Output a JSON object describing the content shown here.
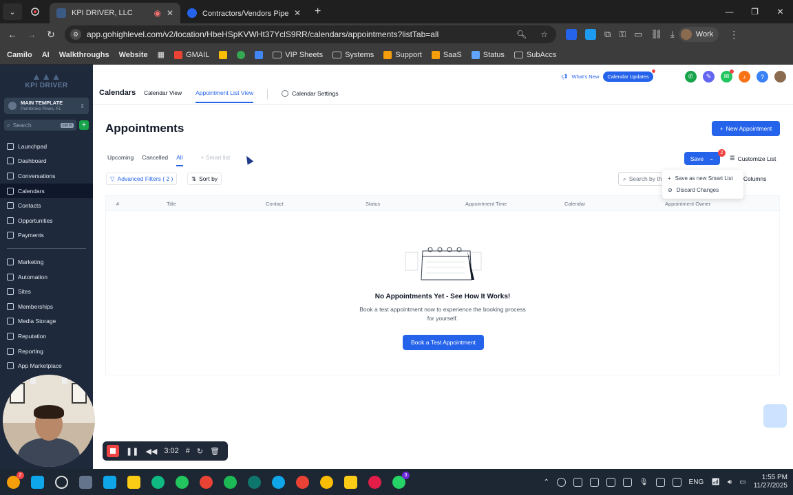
{
  "browser": {
    "tabs": [
      {
        "title": "KPI DRIVER, LLC",
        "active": true
      },
      {
        "title": "Contractors/Vendors Pipeline 📋",
        "active": false
      }
    ],
    "url": "app.gohighlevel.com/v2/location/HbeHSpKVWHt37YclS9RR/calendars/appointments?listTab=all",
    "profile_label": "Work",
    "bookmarks": [
      "Camilo",
      "AI",
      "Walkthroughs",
      "Website",
      "GMAIL",
      "VIP Sheets",
      "Systems",
      "Support",
      "SaaS",
      "Status",
      "SubAccs"
    ]
  },
  "sidebar": {
    "logo_text": "KPI DRIVER",
    "account_name": "MAIN TEMPLATE",
    "account_location": "Pembroke Pines, FL",
    "search_placeholder": "Search",
    "search_shortcut": "ctrl K",
    "nav_primary": [
      "Launchpad",
      "Dashboard",
      "Conversations",
      "Calendars",
      "Contacts",
      "Opportunities",
      "Payments"
    ],
    "nav_secondary": [
      "Marketing",
      "Automation",
      "Sites",
      "Memberships",
      "Media Storage",
      "Reputation",
      "Reporting",
      "App Marketplace"
    ],
    "active_item": "Calendars"
  },
  "topnav": {
    "title": "Calendars",
    "tabs": [
      "Calendar View",
      "Appointment List View"
    ],
    "active_tab": "Appointment List View",
    "settings_label": "Calendar Settings",
    "whats_new": "What's New",
    "updates_pill": "Calendar Updates"
  },
  "page": {
    "heading": "Appointments",
    "new_button": "New Appointment",
    "filter_tabs": [
      "Upcoming",
      "Cancelled",
      "All"
    ],
    "active_filter": "All",
    "smart_list": "Smart list",
    "save_label": "Save",
    "save_badge": "2",
    "customize_label": "Customize List",
    "advanced_filters": "Advanced Filters ( 2 )",
    "sort_by": "Sort by",
    "search_placeholder": "Search by th",
    "manage_columns": "ge Columns",
    "dropdown": [
      "Save as new Smart List",
      "Discard Changes"
    ],
    "columns": [
      "#",
      "Title",
      "Contact",
      "Status",
      "Appointment Time",
      "Calendar",
      "Appointment Owner"
    ],
    "empty_title": "No Appointments Yet - See How It Works!",
    "empty_desc": "Book a test appointment now to experience the booking process for yourself.",
    "book_button": "Book a Test Appointment"
  },
  "recorder": {
    "time": "3:02"
  },
  "taskbar": {
    "language": "ENG",
    "time": "1:55 PM",
    "date": "11/27/2025"
  },
  "colors": {
    "accent": "#2563eb",
    "sidebar": "#1e293b",
    "danger": "#ef4444"
  }
}
